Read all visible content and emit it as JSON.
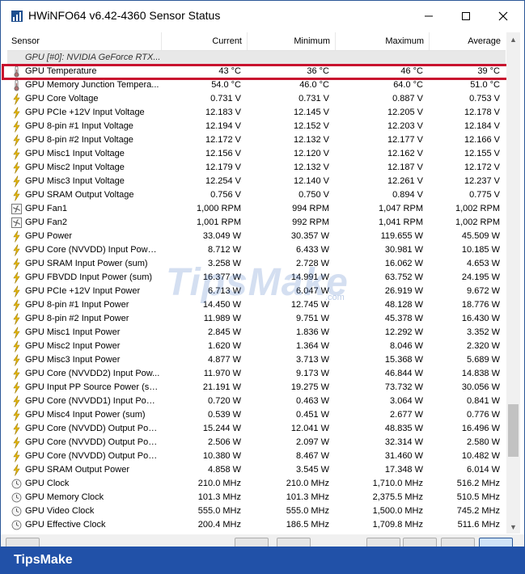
{
  "window": {
    "title": "HWiNFO64 v6.42-4360 Sensor Status"
  },
  "columns": {
    "sensor": "Sensor",
    "current": "Current",
    "minimum": "Minimum",
    "maximum": "Maximum",
    "average": "Average"
  },
  "group_label": "GPU [#0]: NVIDIA GeForce RTX...",
  "rows": [
    {
      "icon": "thermometer-icon",
      "name": "GPU Temperature",
      "current": "43 °C",
      "minimum": "36 °C",
      "maximum": "46 °C",
      "average": "39 °C",
      "highlighted": true
    },
    {
      "icon": "thermometer-icon",
      "name": "GPU Memory Junction Tempera...",
      "current": "54.0 °C",
      "minimum": "46.0 °C",
      "maximum": "64.0 °C",
      "average": "51.0 °C"
    },
    {
      "icon": "lightning-icon",
      "name": "GPU Core Voltage",
      "current": "0.731 V",
      "minimum": "0.731 V",
      "maximum": "0.887 V",
      "average": "0.753 V"
    },
    {
      "icon": "lightning-icon",
      "name": "GPU PCIe +12V Input Voltage",
      "current": "12.183 V",
      "minimum": "12.145 V",
      "maximum": "12.205 V",
      "average": "12.178 V"
    },
    {
      "icon": "lightning-icon",
      "name": "GPU 8-pin #1 Input Voltage",
      "current": "12.194 V",
      "minimum": "12.152 V",
      "maximum": "12.203 V",
      "average": "12.184 V"
    },
    {
      "icon": "lightning-icon",
      "name": "GPU 8-pin #2 Input Voltage",
      "current": "12.172 V",
      "minimum": "12.132 V",
      "maximum": "12.177 V",
      "average": "12.166 V"
    },
    {
      "icon": "lightning-icon",
      "name": "GPU Misc1 Input Voltage",
      "current": "12.156 V",
      "minimum": "12.120 V",
      "maximum": "12.162 V",
      "average": "12.155 V"
    },
    {
      "icon": "lightning-icon",
      "name": "GPU Misc2 Input Voltage",
      "current": "12.179 V",
      "minimum": "12.132 V",
      "maximum": "12.187 V",
      "average": "12.172 V"
    },
    {
      "icon": "lightning-icon",
      "name": "GPU Misc3 Input Voltage",
      "current": "12.254 V",
      "minimum": "12.140 V",
      "maximum": "12.261 V",
      "average": "12.237 V"
    },
    {
      "icon": "lightning-icon",
      "name": "GPU SRAM Output Voltage",
      "current": "0.756 V",
      "minimum": "0.750 V",
      "maximum": "0.894 V",
      "average": "0.775 V"
    },
    {
      "icon": "fan-icon",
      "name": "GPU Fan1",
      "current": "1,000 RPM",
      "minimum": "994 RPM",
      "maximum": "1,047 RPM",
      "average": "1,002 RPM"
    },
    {
      "icon": "fan-icon",
      "name": "GPU Fan2",
      "current": "1,001 RPM",
      "minimum": "992 RPM",
      "maximum": "1,041 RPM",
      "average": "1,002 RPM"
    },
    {
      "icon": "lightning-icon",
      "name": "GPU Power",
      "current": "33.049 W",
      "minimum": "30.357 W",
      "maximum": "119.655 W",
      "average": "45.509 W"
    },
    {
      "icon": "lightning-icon",
      "name": "GPU Core (NVVDD) Input Power...",
      "current": "8.712 W",
      "minimum": "6.433 W",
      "maximum": "30.981 W",
      "average": "10.185 W"
    },
    {
      "icon": "lightning-icon",
      "name": "GPU SRAM Input Power (sum)",
      "current": "3.258 W",
      "minimum": "2.728 W",
      "maximum": "16.062 W",
      "average": "4.653 W"
    },
    {
      "icon": "lightning-icon",
      "name": "GPU FBVDD Input Power (sum)",
      "current": "16.377 W",
      "minimum": "14.991 W",
      "maximum": "63.752 W",
      "average": "24.195 W"
    },
    {
      "icon": "lightning-icon",
      "name": "GPU PCIe +12V Input Power",
      "current": "6.713 W",
      "minimum": "6.047 W",
      "maximum": "26.919 W",
      "average": "9.672 W"
    },
    {
      "icon": "lightning-icon",
      "name": "GPU 8-pin #1 Input Power",
      "current": "14.450 W",
      "minimum": "12.745 W",
      "maximum": "48.128 W",
      "average": "18.776 W"
    },
    {
      "icon": "lightning-icon",
      "name": "GPU 8-pin #2 Input Power",
      "current": "11.989 W",
      "minimum": "9.751 W",
      "maximum": "45.378 W",
      "average": "16.430 W"
    },
    {
      "icon": "lightning-icon",
      "name": "GPU Misc1 Input Power",
      "current": "2.845 W",
      "minimum": "1.836 W",
      "maximum": "12.292 W",
      "average": "3.352 W"
    },
    {
      "icon": "lightning-icon",
      "name": "GPU Misc2 Input Power",
      "current": "1.620 W",
      "minimum": "1.364 W",
      "maximum": "8.046 W",
      "average": "2.320 W"
    },
    {
      "icon": "lightning-icon",
      "name": "GPU Misc3 Input Power",
      "current": "4.877 W",
      "minimum": "3.713 W",
      "maximum": "15.368 W",
      "average": "5.689 W"
    },
    {
      "icon": "lightning-icon",
      "name": "GPU Core (NVVDD2) Input Pow...",
      "current": "11.970 W",
      "minimum": "9.173 W",
      "maximum": "46.844 W",
      "average": "14.838 W"
    },
    {
      "icon": "lightning-icon",
      "name": "GPU Input PP Source Power (sum)",
      "current": "21.191 W",
      "minimum": "19.275 W",
      "maximum": "73.732 W",
      "average": "30.056 W"
    },
    {
      "icon": "lightning-icon",
      "name": "GPU Core (NVVDD1) Input Powe...",
      "current": "0.720 W",
      "minimum": "0.463 W",
      "maximum": "3.064 W",
      "average": "0.841 W"
    },
    {
      "icon": "lightning-icon",
      "name": "GPU Misc4 Input Power (sum)",
      "current": "0.539 W",
      "minimum": "0.451 W",
      "maximum": "2.677 W",
      "average": "0.776 W"
    },
    {
      "icon": "lightning-icon",
      "name": "GPU Core (NVVDD) Output Pow...",
      "current": "15.244 W",
      "minimum": "12.041 W",
      "maximum": "48.835 W",
      "average": "16.496 W"
    },
    {
      "icon": "lightning-icon",
      "name": "GPU Core (NVVDD) Output Power",
      "current": "2.506 W",
      "minimum": "2.097 W",
      "maximum": "32.314 W",
      "average": "2.580 W"
    },
    {
      "icon": "lightning-icon",
      "name": "GPU Core (NVVDD) Output Power",
      "current": "10.380 W",
      "minimum": "8.467 W",
      "maximum": "31.460 W",
      "average": "10.482 W"
    },
    {
      "icon": "lightning-icon",
      "name": "GPU SRAM Output Power",
      "current": "4.858 W",
      "minimum": "3.545 W",
      "maximum": "17.348 W",
      "average": "6.014 W"
    },
    {
      "icon": "clock-icon",
      "name": "GPU Clock",
      "current": "210.0 MHz",
      "minimum": "210.0 MHz",
      "maximum": "1,710.0 MHz",
      "average": "516.2 MHz"
    },
    {
      "icon": "clock-icon",
      "name": "GPU Memory Clock",
      "current": "101.3 MHz",
      "minimum": "101.3 MHz",
      "maximum": "2,375.5 MHz",
      "average": "510.5 MHz"
    },
    {
      "icon": "clock-icon",
      "name": "GPU Video Clock",
      "current": "555.0 MHz",
      "minimum": "555.0 MHz",
      "maximum": "1,500.0 MHz",
      "average": "745.2 MHz"
    },
    {
      "icon": "clock-icon",
      "name": "GPU Effective Clock",
      "current": "200.4 MHz",
      "minimum": "186.5 MHz",
      "maximum": "1,709.8 MHz",
      "average": "511.6 MHz"
    }
  ],
  "watermark": {
    "text": "TipsMake",
    "sub": ".com"
  },
  "brand": {
    "name": "TipsMake"
  },
  "colors": {
    "highlight": "#c8102e",
    "brandbar": "#2151a8",
    "bolt": "#e8b90c"
  }
}
